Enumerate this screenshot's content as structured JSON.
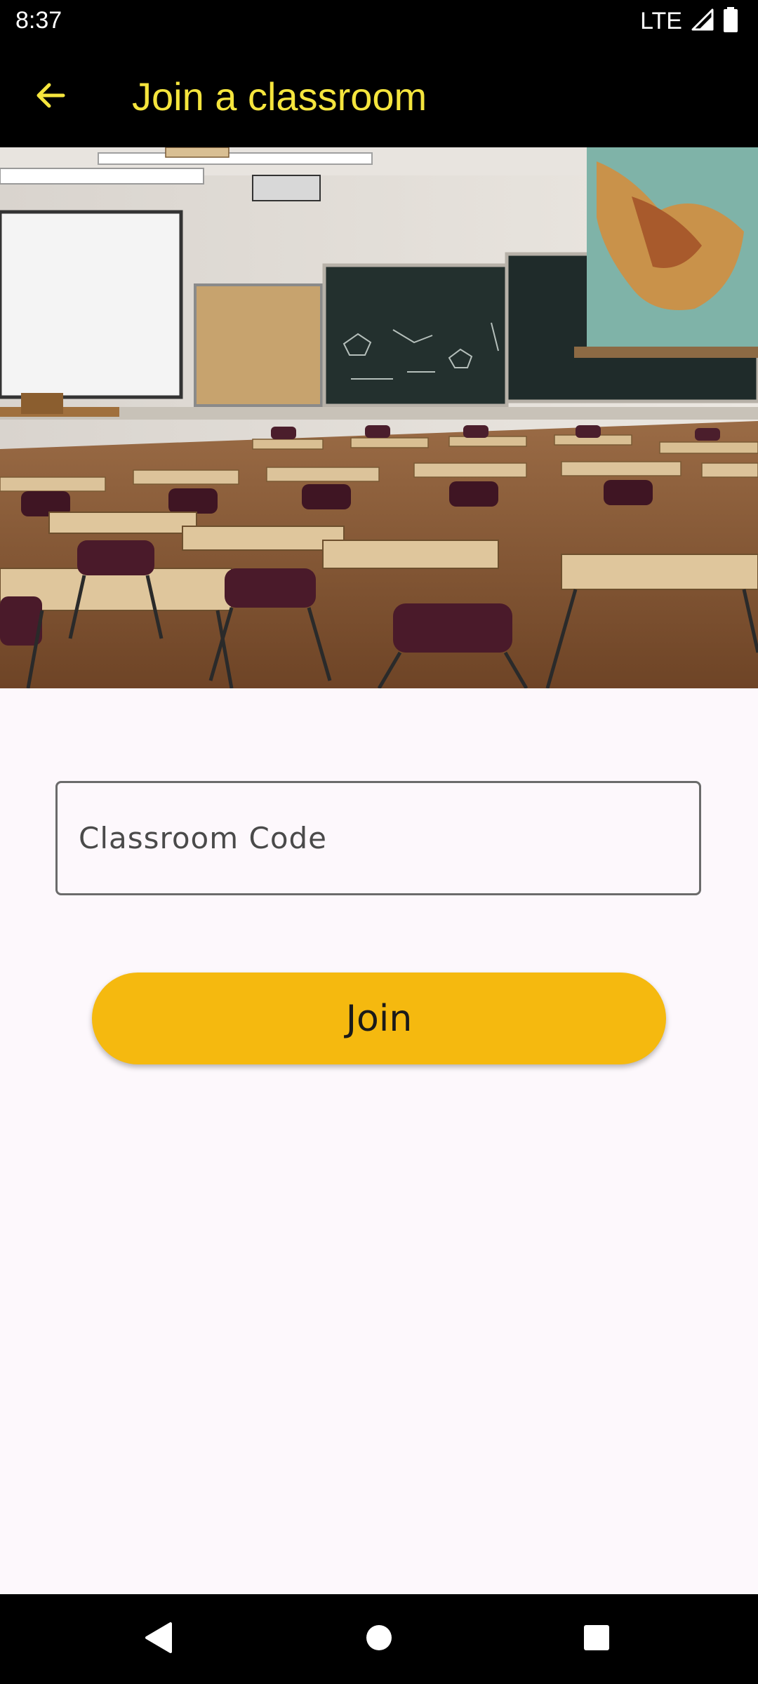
{
  "status_bar": {
    "time": "8:37",
    "network": "LTE",
    "icons": [
      "signal-icon",
      "battery-icon"
    ]
  },
  "app_bar": {
    "title": "Join a classroom",
    "back_icon": "arrow-back-icon",
    "title_color": "#f5e53d",
    "background": "#000000"
  },
  "hero": {
    "description_icon": "classroom-photo"
  },
  "form": {
    "code_field": {
      "placeholder": "Classroom Code",
      "value": ""
    },
    "join_button": {
      "label": "Join",
      "color": "#f5b90f"
    }
  },
  "nav_bar": {
    "buttons": [
      "back-triangle-icon",
      "home-circle-icon",
      "recents-square-icon"
    ]
  },
  "colors": {
    "page_background": "#fdf8fc",
    "accent": "#f5b90f"
  }
}
